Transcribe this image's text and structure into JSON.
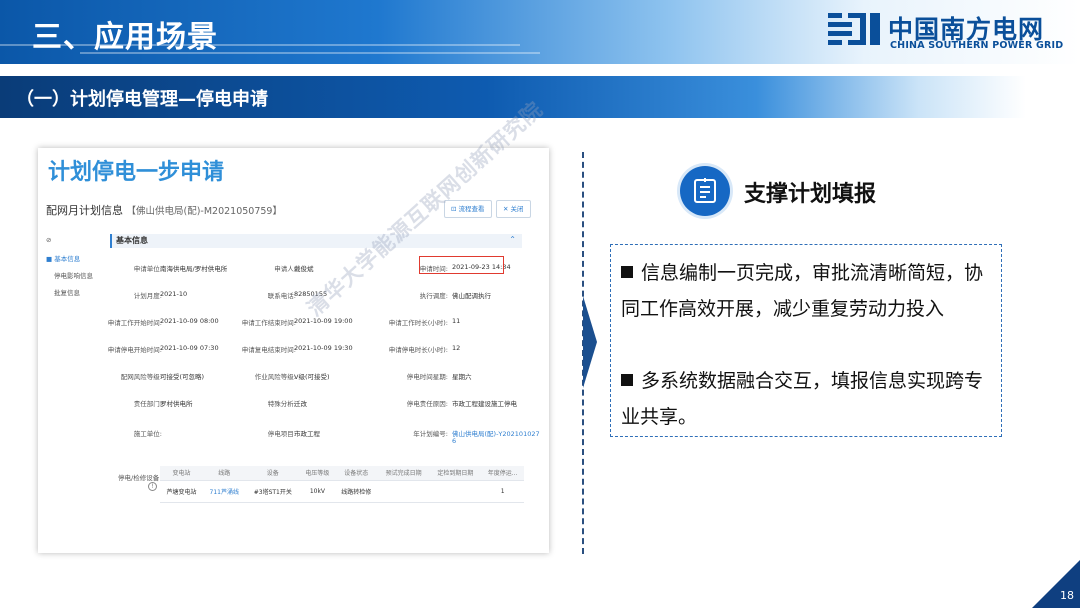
{
  "header": {
    "title": "三、应用场景",
    "logo_cn": "中国南方电网",
    "logo_en": "CHINA SOUTHERN POWER GRID"
  },
  "section": {
    "title": "（一）计划停电管理—停电申请"
  },
  "screenshot": {
    "heading": "计划停电一步申请",
    "subtitle_main": "配网月计划信息",
    "subtitle_code": "【佛山供电局(配)-M2021050759】",
    "btn_process": "⊡ 流程查看",
    "btn_close": "✕ 关闭",
    "nav": [
      "⊘",
      "■ 基本信息",
      "停电影响信息",
      "批复信息"
    ],
    "info_title": "基本信息",
    "collapse_glyph": "⌃",
    "rows": [
      [
        [
          "申请单位:",
          "南海供电局/罗村供电所"
        ],
        [
          "申请人:",
          "戴俊斌"
        ],
        [
          "申请时间:",
          "2021-09-23 14:34"
        ]
      ],
      [
        [
          "计划月度:",
          "2021-10"
        ],
        [
          "联系电话:",
          "82850155"
        ],
        [
          "执行调度:",
          "佛山配调执行"
        ]
      ],
      [
        [
          "申请工作开始时间:",
          "2021-10-09 08:00"
        ],
        [
          "申请工作结束时间:",
          "2021-10-09 19:00"
        ],
        [
          "申请工作时长(小时):",
          "11"
        ]
      ],
      [
        [
          "申请停电开始时间:",
          "2021-10-09 07:30"
        ],
        [
          "申请复电结束时间:",
          "2021-10-09 19:30"
        ],
        [
          "申请停电时长(小时):",
          "12"
        ]
      ],
      [
        [
          "配网风险等级:",
          "可接受(可忽略)"
        ],
        [
          "作业风险等级:",
          "V级(可接受)"
        ],
        [
          "停电时间星期:",
          "星期六"
        ]
      ],
      [
        [
          "责任部门:",
          "罗村供电所"
        ],
        [
          "特殊分析:",
          "迁改"
        ],
        [
          "停电责任原因:",
          "市政工程建设施工停电"
        ]
      ],
      [
        [
          "施工单位:",
          ""
        ],
        [
          "停电项目:",
          "市政工程"
        ],
        [
          "年计划编号:",
          "佛山供电局(配)-Y202101027"
        ]
      ]
    ],
    "row7_extra": "6",
    "table_label": "停电/检修设备:",
    "table_info_glyph": "!",
    "table_headers": [
      "变电站",
      "线路",
      "设备",
      "电压等级",
      "设备状态",
      "预试完成日期",
      "定检到期日期",
      "年度停运..."
    ],
    "table_row": [
      "芦塘变电站",
      "711芦涌线",
      "#3塔ST1开关",
      "10kV",
      "线路转检修",
      "",
      "",
      "1"
    ]
  },
  "watermark": "清华大学能源互联网创新研究院",
  "feature": {
    "title": "支撑计划填报",
    "bullets": [
      "信息编制一页完成，审批流清晰简短，协同工作高效开展，减少重复劳动力投入",
      "多系统数据融合交互，填报信息实现跨专业共享。"
    ]
  },
  "page_number": "18",
  "colors": {
    "brand": "#0a4f9a",
    "accent": "#2f8fd8",
    "highlight": "#e03a2f"
  }
}
